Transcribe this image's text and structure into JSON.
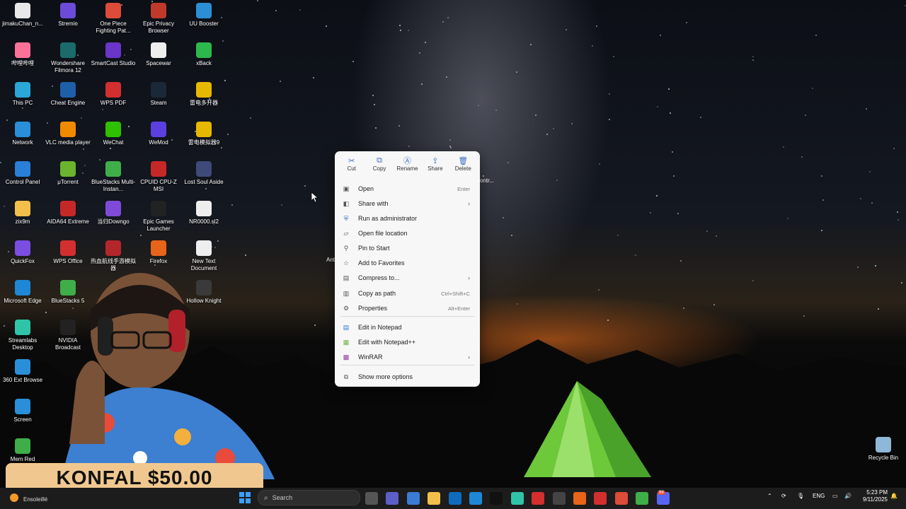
{
  "desktop_icons": [
    {
      "label": "jimakuChan_n...",
      "icon": "app-icon",
      "color": "#e8e8e8"
    },
    {
      "label": "Stremio",
      "icon": "stremio-icon",
      "color": "#6c4bd8"
    },
    {
      "label": "One Piece Fighting Pat...",
      "icon": "chrome-icon",
      "color": "#dd4b39"
    },
    {
      "label": "Epic Privacy Browser",
      "icon": "epic-browser-icon",
      "color": "#c0392b"
    },
    {
      "label": "UU Booster",
      "icon": "uu-booster-icon",
      "color": "#2c8fd6"
    },
    {
      "label": "哔哩哔哩",
      "icon": "bilibili-icon",
      "color": "#fb7299"
    },
    {
      "label": "Wondershare Filmora 12",
      "icon": "filmora-icon",
      "color": "#1b6b6b"
    },
    {
      "label": "SmartCast Studio",
      "icon": "smartcast-icon",
      "color": "#6a35c9"
    },
    {
      "label": "Spacewar",
      "icon": "file-icon",
      "color": "#eeeeee"
    },
    {
      "label": "xBack",
      "icon": "xback-icon",
      "color": "#2db84d"
    },
    {
      "label": "This PC",
      "icon": "this-pc-icon",
      "color": "#2aa6d8"
    },
    {
      "label": "Cheat Engine",
      "icon": "cheat-engine-icon",
      "color": "#1f5fa8"
    },
    {
      "label": "WPS PDF",
      "icon": "wps-pdf-icon",
      "color": "#d32f2f"
    },
    {
      "label": "Steam",
      "icon": "steam-icon",
      "color": "#1b2838"
    },
    {
      "label": "雷电多开器",
      "icon": "ldplayer-multi-icon",
      "color": "#e6b800"
    },
    {
      "label": "Network",
      "icon": "network-icon",
      "color": "#2a8fd8"
    },
    {
      "label": "VLC media player",
      "icon": "vlc-icon",
      "color": "#f08a00"
    },
    {
      "label": "WeChat",
      "icon": "wechat-icon",
      "color": "#2dc100"
    },
    {
      "label": "WeMod",
      "icon": "wemod-icon",
      "color": "#5b3fe0"
    },
    {
      "label": "雷电模拟器9",
      "icon": "ldplayer-icon",
      "color": "#e6b800"
    },
    {
      "label": "Control Panel",
      "icon": "control-panel-icon",
      "color": "#2a7fd8"
    },
    {
      "label": "μTorrent",
      "icon": "utorrent-icon",
      "color": "#6bb42e"
    },
    {
      "label": "BlueStacks Multi-Instan...",
      "icon": "bluestacks-icon",
      "color": "#3fae49"
    },
    {
      "label": "CPUID CPU-Z MSI",
      "icon": "cpuz-icon",
      "color": "#c62828"
    },
    {
      "label": "Lost Soul Aside",
      "icon": "game-icon",
      "color": "#3d4a7a"
    },
    {
      "label": "zix9m",
      "icon": "folder-icon",
      "color": "#f2c04a"
    },
    {
      "label": "AIDA64 Extreme",
      "icon": "aida64-icon",
      "color": "#c62828"
    },
    {
      "label": "当归Downgo",
      "icon": "downgo-icon",
      "color": "#7e4bd8"
    },
    {
      "label": "Epic Games Launcher",
      "icon": "epic-games-icon",
      "color": "#222222"
    },
    {
      "label": "NR0000.sl2",
      "icon": "file-icon",
      "color": "#eeeeee"
    },
    {
      "label": "QuickFox",
      "icon": "quickfox-icon",
      "color": "#7b4de0"
    },
    {
      "label": "WPS Office",
      "icon": "wps-office-icon",
      "color": "#d32f2f"
    },
    {
      "label": "热血航线手游模拟器",
      "icon": "game-icon",
      "color": "#b3262b"
    },
    {
      "label": "Firefox",
      "icon": "firefox-icon",
      "color": "#e8641a"
    },
    {
      "label": "New Text Document",
      "icon": "text-file-icon",
      "color": "#eeeeee"
    },
    {
      "label": "Microsoft Edge",
      "icon": "edge-icon",
      "color": "#1e88d6"
    },
    {
      "label": "BlueStacks 5",
      "icon": "bluestacks-icon",
      "color": "#3fae49"
    },
    {
      "label": "Hollow Knight",
      "icon": "hollow-knight-icon",
      "color": "#3a3a3a"
    },
    {
      "label": "Streamlabs Desktop",
      "icon": "streamlabs-icon",
      "color": "#2fc4a8"
    },
    {
      "label": "NVIDIA Broadcast",
      "icon": "nvidia-icon",
      "color": "#222222"
    },
    {
      "label": "360 Ext Browse",
      "icon": "360-browser-icon",
      "color": "#2a8fd8"
    },
    {
      "label": "Screen",
      "icon": "app-icon",
      "color": "#2a8fd8"
    },
    {
      "label": "Mem Red",
      "icon": "mem-reduct-icon",
      "color": "#3fae49"
    },
    {
      "label": "Recycle Bin",
      "icon": "recycle-bin-icon",
      "color": "#8fb8d8"
    }
  ],
  "context_menu": {
    "actions": [
      {
        "label": "Cut",
        "icon": "cut-icon"
      },
      {
        "label": "Copy",
        "icon": "copy-icon"
      },
      {
        "label": "Rename",
        "icon": "rename-icon"
      },
      {
        "label": "Share",
        "icon": "share-icon"
      },
      {
        "label": "Delete",
        "icon": "delete-icon"
      }
    ],
    "items": [
      {
        "label": "Open",
        "shortcut": "Enter",
        "icon": "open-icon",
        "submenu": false
      },
      {
        "label": "Share with",
        "shortcut": "",
        "icon": "share-with-icon",
        "submenu": true
      },
      {
        "label": "Run as administrator",
        "shortcut": "",
        "icon": "shield-icon",
        "submenu": false
      },
      {
        "label": "Open file location",
        "shortcut": "",
        "icon": "folder-open-icon",
        "submenu": false
      },
      {
        "label": "Pin to Start",
        "shortcut": "",
        "icon": "pin-icon",
        "submenu": false
      },
      {
        "label": "Add to Favorites",
        "shortcut": "",
        "icon": "star-icon",
        "submenu": false
      },
      {
        "label": "Compress to...",
        "shortcut": "",
        "icon": "compress-icon",
        "submenu": true
      },
      {
        "label": "Copy as path",
        "shortcut": "Ctrl+Shift+C",
        "icon": "copy-path-icon",
        "submenu": false
      },
      {
        "label": "Properties",
        "shortcut": "Alt+Enter",
        "icon": "wrench-icon",
        "submenu": false
      },
      {
        "label": "Edit in Notepad",
        "shortcut": "",
        "icon": "notepad-icon",
        "submenu": false
      },
      {
        "label": "Edit with Notepad++",
        "shortcut": "",
        "icon": "notepadpp-icon",
        "submenu": false
      },
      {
        "label": "WinRAR",
        "shortcut": "",
        "icon": "winrar-icon",
        "submenu": true
      },
      {
        "label": "Show more options",
        "shortcut": "",
        "icon": "more-options-icon",
        "submenu": false
      }
    ]
  },
  "donation": {
    "text": "KONFAL $50.00"
  },
  "taskbar": {
    "weather": "Ensoleillé",
    "search_placeholder": "Search",
    "language": "ENG",
    "time": "5:23 PM",
    "date": "9/11/2025",
    "apps": [
      "task-view-icon",
      "teams-icon",
      "store-icon",
      "file-explorer-icon",
      "outlook-icon",
      "edge-icon",
      "netflix-icon",
      "streamlabs-icon",
      "opera-icon",
      "github-icon",
      "firefox-icon",
      "wps-icon",
      "chrome-icon",
      "bluestacks-icon",
      "discord-icon"
    ],
    "discord_badge": "99"
  },
  "background_labels": {
    "partial_left": "Ant",
    "partial_right": "ontr..."
  }
}
